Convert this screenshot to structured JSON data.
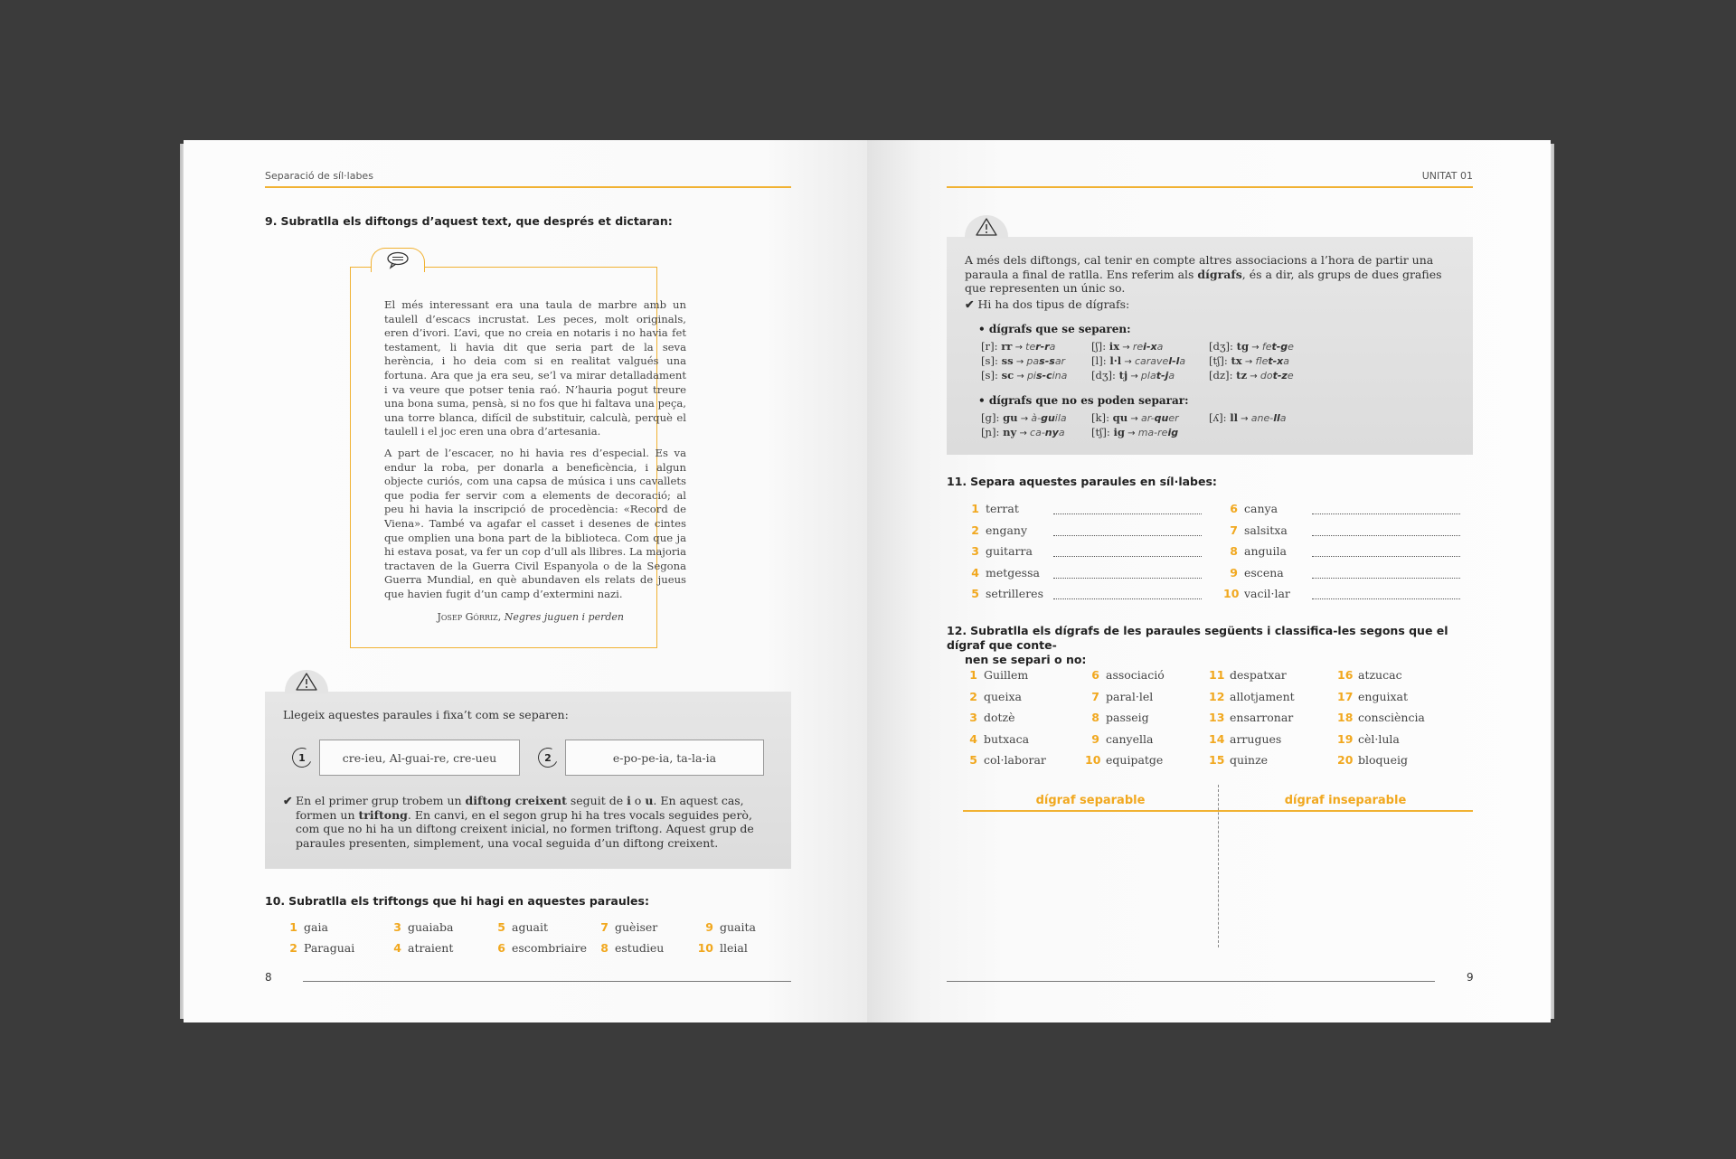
{
  "left_page": {
    "running_head": "Separació de síl·labes",
    "folio": "8",
    "q9": {
      "num": "9.",
      "title": "Subratlla els diftongs d’aquest text, que després et dictaran:",
      "icon": "speech-bubble-icon",
      "paragraphs": [
        "El més interessant era una taula de marbre amb un taulell d’escacs incrustat. Les peces, molt originals, eren d’ivori. L’avi, que no creia en notaris i no havia fet testament, li havia dit que seria part de la seva herència, i ho deia com si en realitat valgués una fortuna. Ara que ja era seu, se’l va mirar detalladament i va veure que potser tenia raó. N’hauria pogut treure una bona suma, pensà, si no fos que hi faltava una peça, una torre blanca, difícil de substituir, calculà, perquè el taulell i el joc eren una obra d’artesania.",
        "A part de l’escacer, no hi havia res d’especial. Es va endur la roba, per donarla a beneficència, i algun objecte curiós, com una capsa de música i uns cavallets que podia fer servir com a elements de decoració; al peu hi havia la inscripció de procedència: «Record de Viena». També va agafar el casset i desenes de cintes que omplien una bona part de la biblioteca. Com que ja hi estava posat, va fer un cop d’ull als llibres. La majoria tractaven de la Guerra Civil Espanyola o de la Segona Guerra Mundial, en què abundaven els relats de jueus que havien fugit d’un camp d’extermini nazi."
      ],
      "author": "Josep Górriz,",
      "work": "Negres juguen i perden"
    },
    "note": {
      "icon": "warning-icon",
      "intro": "Llegeix aquestes paraules i fixa’t com se separen:",
      "groups": [
        {
          "num": "1",
          "text": "cre-ieu, Al-guai-re, cre-ueu"
        },
        {
          "num": "2",
          "text": "e-po-pe-ia, ta-la-ia"
        }
      ],
      "check": "✔",
      "expl_1": "En el primer grup trobem un ",
      "expl_b1": "diftong creixent",
      "expl_2": " seguit de ",
      "expl_b2": "i",
      "expl_3": " o ",
      "expl_b3": "u",
      "expl_4": ". En aquest cas, formen un ",
      "expl_b4": "triftong",
      "expl_5": ". En canvi, en el segon grup hi ha tres vocals seguides però, com que no hi ha un diftong creixent inicial, no formen triftong. Aquest grup de paraules presenten, simplement, una vocal seguida d’un diftong creixent."
    },
    "q10": {
      "num": "10.",
      "title": "Subratlla els triftongs que hi hagi en aquestes paraules:",
      "words": [
        {
          "n": "1",
          "w": "gaia"
        },
        {
          "n": "2",
          "w": "Paraguai"
        },
        {
          "n": "3",
          "w": "guaiaba"
        },
        {
          "n": "4",
          "w": "atraient"
        },
        {
          "n": "5",
          "w": "aguait"
        },
        {
          "n": "6",
          "w": "escombriaire"
        },
        {
          "n": "7",
          "w": "guèiser"
        },
        {
          "n": "8",
          "w": "estudieu"
        },
        {
          "n": "9",
          "w": "guaita"
        },
        {
          "n": "10",
          "w": "lleial"
        }
      ]
    }
  },
  "right_page": {
    "running_head": "UNITAT 01",
    "folio": "9",
    "note": {
      "icon": "warning-icon",
      "intro_1": "A més dels diftongs, cal tenir en compte altres associacions a l’hora de partir una paraula a final de ratlla. Ens referim als ",
      "intro_b": "dígrafs",
      "intro_2": ", és a dir, als grups de dues grafies que representen un únic so.",
      "check": "✔",
      "types": "Hi ha dos tipus de dígrafs:",
      "sep_head": "• dígrafs que se separen:",
      "sep": [
        {
          "ph": "[r]:",
          "dg": "rr",
          "pre": "te",
          "mid": "r-r",
          "post": "a"
        },
        {
          "ph": "[ʃ]:",
          "dg": "ix",
          "pre": "re",
          "mid": "i-x",
          "post": "a"
        },
        {
          "ph": "[dʒ]:",
          "dg": "tg",
          "pre": "fe",
          "mid": "t-g",
          "post": "e"
        },
        {
          "ph": "[s]:",
          "dg": "ss",
          "pre": "pa",
          "mid": "s-s",
          "post": "ar"
        },
        {
          "ph": "[l]:",
          "dg": "l·l",
          "pre": "carave",
          "mid": "l-l",
          "post": "a"
        },
        {
          "ph": "[tʃ]:",
          "dg": "tx",
          "pre": "fle",
          "mid": "t-x",
          "post": "a"
        },
        {
          "ph": "[s]:",
          "dg": "sc",
          "pre": "pi",
          "mid": "s-c",
          "post": "ina"
        },
        {
          "ph": "[dʒ]:",
          "dg": "tj",
          "pre": "pla",
          "mid": "t-j",
          "post": "a"
        },
        {
          "ph": "[dz]:",
          "dg": "tz",
          "pre": "do",
          "mid": "t-z",
          "post": "e"
        }
      ],
      "nosep_head": "• dígrafs que no es poden separar:",
      "nosep": [
        {
          "ph": "[g]:",
          "dg": "gu",
          "pre": "à-",
          "mid": "gu",
          "post": "ila"
        },
        {
          "ph": "[k]:",
          "dg": "qu",
          "pre": "ar-",
          "mid": "qu",
          "post": "er"
        },
        {
          "ph": "[ʎ]:",
          "dg": "ll",
          "pre": "ane-",
          "mid": "ll",
          "post": "a"
        },
        {
          "ph": "[ɲ]:",
          "dg": "ny",
          "pre": "ca-",
          "mid": "ny",
          "post": "a"
        },
        {
          "ph": "[tʃ]:",
          "dg": "ig",
          "pre": "ma-re",
          "mid": "ig",
          "post": ""
        }
      ]
    },
    "q11": {
      "num": "11.",
      "title": "Separa aquestes paraules en síl·labes:",
      "words": [
        {
          "n": "1",
          "w": "terrat"
        },
        {
          "n": "2",
          "w": "engany"
        },
        {
          "n": "3",
          "w": "guitarra"
        },
        {
          "n": "4",
          "w": "metgessa"
        },
        {
          "n": "5",
          "w": "setrilleres"
        },
        {
          "n": "6",
          "w": "canya"
        },
        {
          "n": "7",
          "w": "salsitxa"
        },
        {
          "n": "8",
          "w": "anguila"
        },
        {
          "n": "9",
          "w": "escena"
        },
        {
          "n": "10",
          "w": "vacil·lar"
        }
      ]
    },
    "q12": {
      "num": "12.",
      "title_line1": "Subratlla els dígrafs de les paraules següents i classifica-les segons que el dígraf que conte-",
      "title_line2": "nen se separi o no:",
      "words": [
        {
          "n": "1",
          "w": "Guillem"
        },
        {
          "n": "2",
          "w": "queixa"
        },
        {
          "n": "3",
          "w": "dotzè"
        },
        {
          "n": "4",
          "w": "butxaca"
        },
        {
          "n": "5",
          "w": "col·laborar"
        },
        {
          "n": "6",
          "w": "associació"
        },
        {
          "n": "7",
          "w": "paral·lel"
        },
        {
          "n": "8",
          "w": "passeig"
        },
        {
          "n": "9",
          "w": "canyella"
        },
        {
          "n": "10",
          "w": "equipatge"
        },
        {
          "n": "11",
          "w": "despatxar"
        },
        {
          "n": "12",
          "w": "allotjament"
        },
        {
          "n": "13",
          "w": "ensarronar"
        },
        {
          "n": "14",
          "w": "arrugues"
        },
        {
          "n": "15",
          "w": "quinze"
        },
        {
          "n": "16",
          "w": "atzucac"
        },
        {
          "n": "17",
          "w": "enguixat"
        },
        {
          "n": "18",
          "w": "consciència"
        },
        {
          "n": "19",
          "w": "cèl·lula"
        },
        {
          "n": "20",
          "w": "bloqueig"
        }
      ],
      "col_1": "dígraf separable",
      "col_2": "dígraf inseparable"
    }
  },
  "colors": {
    "accent": "#f1b233",
    "number": "#f1a81f",
    "background": "#3b3b3b"
  }
}
